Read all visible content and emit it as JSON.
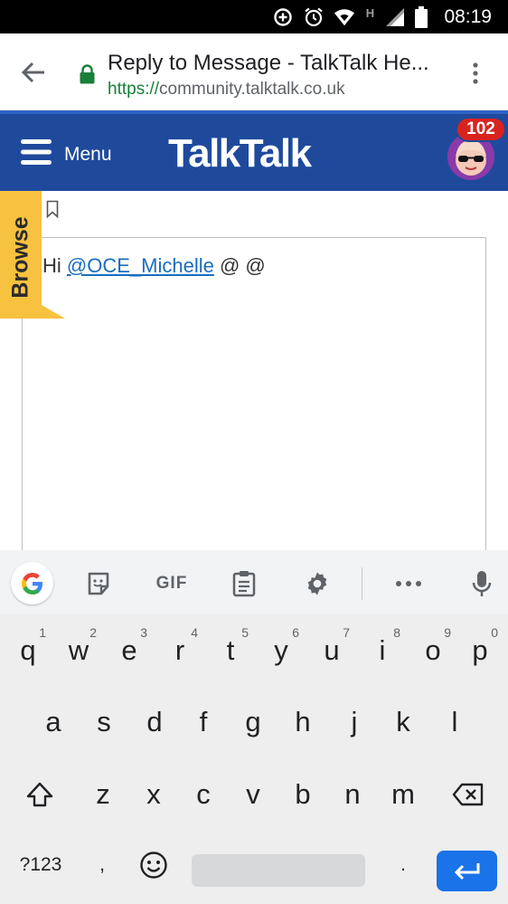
{
  "status_bar": {
    "time": "08:19",
    "icons": [
      "data-saver-icon",
      "alarm-icon",
      "wifi-icon",
      "network-h-icon",
      "signal-icon",
      "battery-icon"
    ],
    "network_label": "H"
  },
  "browser": {
    "page_title": "Reply to Message - TalkTalk He...",
    "url_scheme": "https://",
    "url_host": "community.talktalk.co.uk"
  },
  "site_header": {
    "menu_label": "Menu",
    "logo_text": "TalkTalk",
    "notification_count": "102",
    "brand_color": "#1f4a9c",
    "badge_color": "#d9231f"
  },
  "editor": {
    "prefix": "Hi ",
    "mention": "@OCE_Michelle",
    "suffix": " @ @"
  },
  "browse_tab": {
    "label": "Browse",
    "color": "#f7c23f"
  },
  "keyboard": {
    "row1": [
      {
        "key": "q",
        "hint": "1"
      },
      {
        "key": "w",
        "hint": "2"
      },
      {
        "key": "e",
        "hint": "3"
      },
      {
        "key": "r",
        "hint": "4"
      },
      {
        "key": "t",
        "hint": "5"
      },
      {
        "key": "y",
        "hint": "6"
      },
      {
        "key": "u",
        "hint": "7"
      },
      {
        "key": "i",
        "hint": "8"
      },
      {
        "key": "o",
        "hint": "9"
      },
      {
        "key": "p",
        "hint": "0"
      }
    ],
    "row2": [
      "a",
      "s",
      "d",
      "f",
      "g",
      "h",
      "j",
      "k",
      "l"
    ],
    "row3": [
      "z",
      "x",
      "c",
      "v",
      "b",
      "n",
      "m"
    ],
    "symbols_label": "?123",
    "comma": ",",
    "period": ".",
    "gif_label": "GIF",
    "accent_color": "#1a73e8"
  }
}
